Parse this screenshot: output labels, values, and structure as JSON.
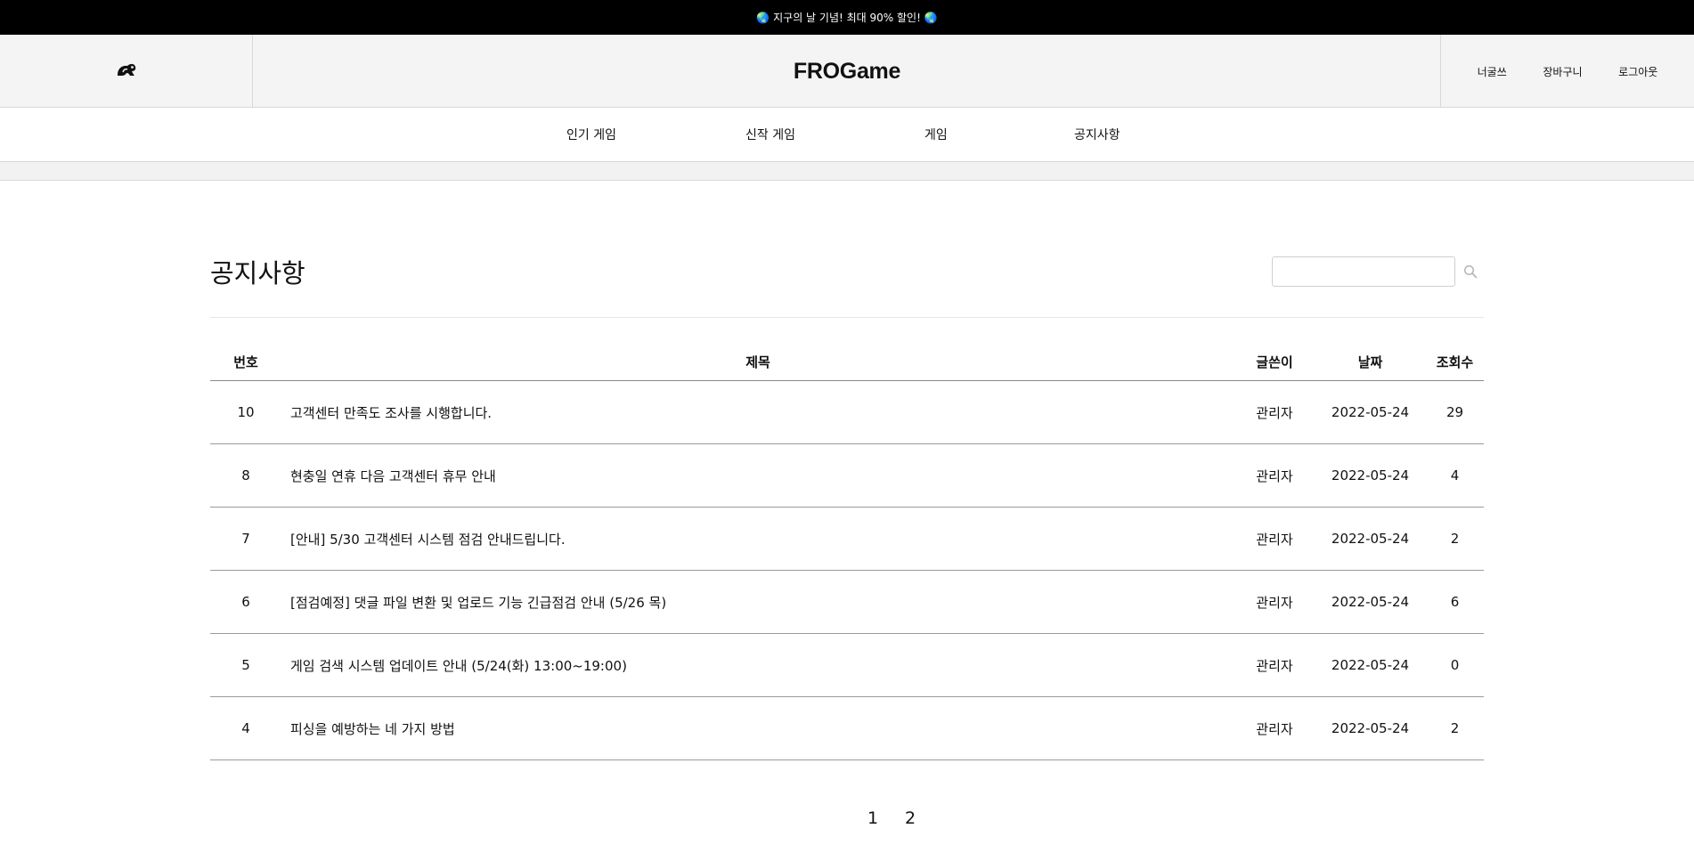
{
  "promo": {
    "text": "🌏 지구의 날 기념! 최대 90% 할인! 🌏"
  },
  "header": {
    "brand": "FROGame",
    "user_links": [
      "너굴쓰",
      "장바구니",
      "로그아웃"
    ]
  },
  "nav": {
    "items": [
      "인기 게임",
      "신작 게임",
      "게임",
      "공지사항"
    ]
  },
  "notice": {
    "title": "공지사항",
    "search": {
      "value": "",
      "placeholder": ""
    },
    "columns": {
      "num": "번호",
      "title": "제목",
      "author": "글쓴이",
      "date": "날짜",
      "views": "조회수"
    },
    "rows": [
      {
        "num": "10",
        "title": "고객센터 만족도 조사를 시행합니다.",
        "author": "관리자",
        "date": "2022-05-24",
        "views": "29"
      },
      {
        "num": "8",
        "title": "현충일 연휴 다음 고객센터 휴무 안내",
        "author": "관리자",
        "date": "2022-05-24",
        "views": "4"
      },
      {
        "num": "7",
        "title": "[안내] 5/30 고객센터 시스템 점검 안내드립니다.",
        "author": "관리자",
        "date": "2022-05-24",
        "views": "2"
      },
      {
        "num": "6",
        "title": "[점검예정] 댓글 파일 변환 및 업로드 기능 긴급점검 안내 (5/26 목)",
        "author": "관리자",
        "date": "2022-05-24",
        "views": "6"
      },
      {
        "num": "5",
        "title": "게임 검색 시스템 업데이트 안내 (5/24(화) 13:00~19:00)",
        "author": "관리자",
        "date": "2022-05-24",
        "views": "0"
      },
      {
        "num": "4",
        "title": "피싱을 예방하는 네 가지 방법",
        "author": "관리자",
        "date": "2022-05-24",
        "views": "2"
      }
    ]
  },
  "pagination": {
    "pages": [
      "1",
      "2"
    ]
  },
  "icons": {
    "logo": "frog-logo-icon",
    "search": "search-icon"
  }
}
